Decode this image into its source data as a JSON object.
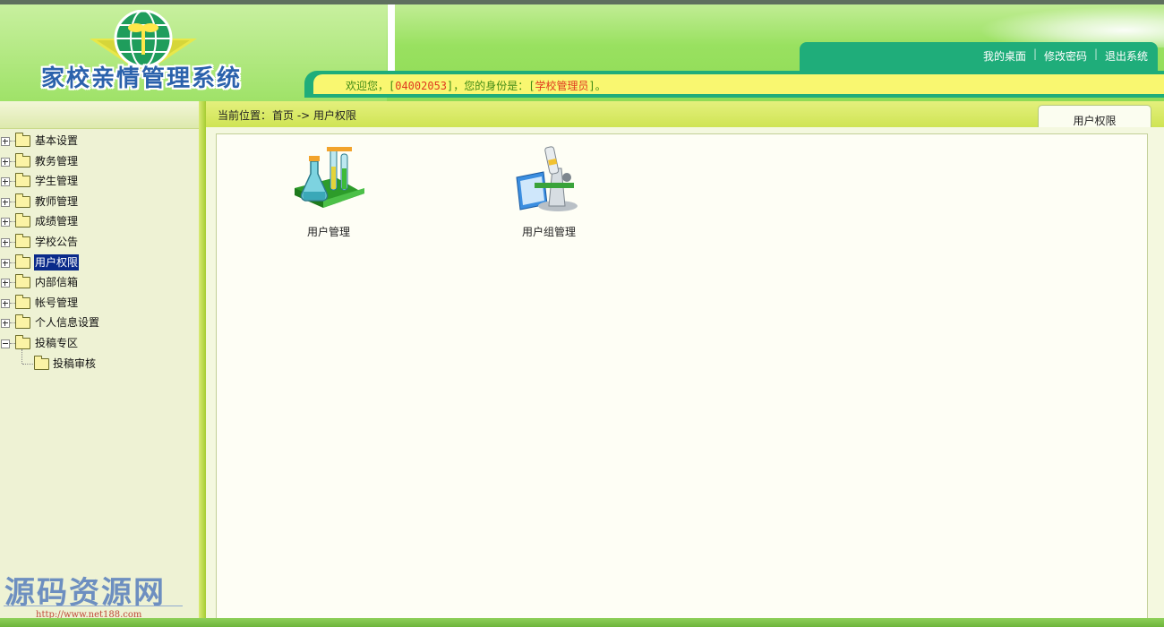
{
  "header": {
    "logo_text": "家校亲情管理系统",
    "toplinks": [
      "我的桌面",
      "修改密码",
      "退出系统"
    ],
    "welcome": {
      "prefix": "欢迎您，[",
      "user_id": "04002053",
      "middle": "]，您的身份是：[",
      "role": "学校管理员",
      "suffix": "]。"
    }
  },
  "sidebar": {
    "items": [
      {
        "label": "基本设置",
        "expanded": false
      },
      {
        "label": "教务管理",
        "expanded": false
      },
      {
        "label": "学生管理",
        "expanded": false
      },
      {
        "label": "教师管理",
        "expanded": false
      },
      {
        "label": "成绩管理",
        "expanded": false
      },
      {
        "label": "学校公告",
        "expanded": false
      },
      {
        "label": "用户权限",
        "expanded": false,
        "selected": true
      },
      {
        "label": "内部信箱",
        "expanded": false
      },
      {
        "label": "帐号管理",
        "expanded": false
      },
      {
        "label": "个人信息设置",
        "expanded": false
      },
      {
        "label": "投稿专区",
        "expanded": true
      }
    ],
    "children": [
      {
        "parent": "投稿专区",
        "label": "投稿审核"
      }
    ]
  },
  "breadcrumb": {
    "label": "当前位置：",
    "path": "首页 -> 用户权限"
  },
  "tab": {
    "label": "用户权限"
  },
  "main": {
    "items": [
      {
        "label": "用户管理",
        "icon": "chemistry-flask-icon"
      },
      {
        "label": "用户组管理",
        "icon": "microscope-icon"
      }
    ]
  },
  "watermark": {
    "text": "源码资源网",
    "url": "http://www.net188.com"
  },
  "colors": {
    "header_green": "#99e160",
    "toplinks_bg": "#1fad7a",
    "welcome_bg": "#f9f770",
    "crumb_bg": "#cfe454",
    "selected_bg": "#0a2a8a",
    "logo_blue": "#2b62ac"
  }
}
